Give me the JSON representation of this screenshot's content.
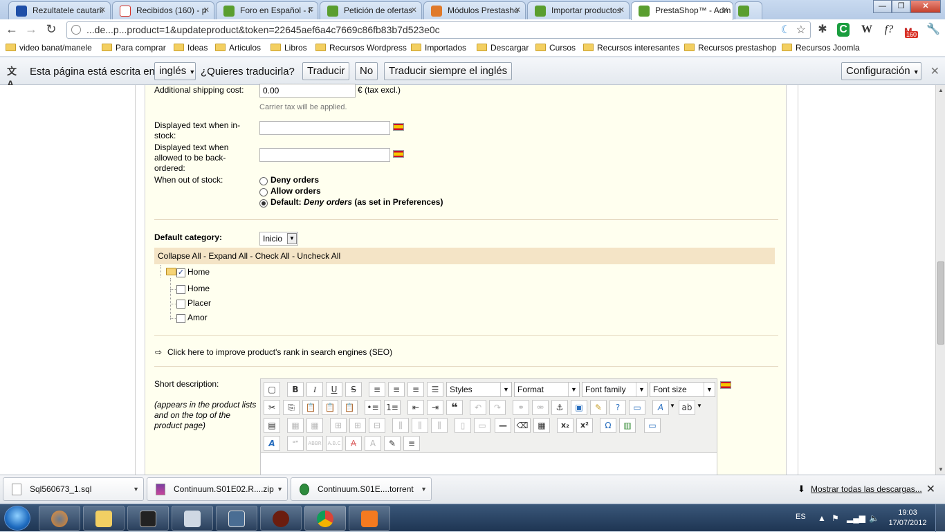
{
  "tabs": [
    {
      "label": "Rezultatele cautarii",
      "icon": "forum-icon",
      "color": "#1f4fa8"
    },
    {
      "label": "Recibidos (160) - p",
      "icon": "gmail-icon",
      "color": "#d93025"
    },
    {
      "label": "Foro en Español - F",
      "icon": "prestashop-icon",
      "color": "#5a9e2f"
    },
    {
      "label": "Petición de ofertas",
      "icon": "prestashop-icon",
      "color": "#5a9e2f"
    },
    {
      "label": "Módulos Prestasho",
      "icon": "job-icon",
      "color": "#e07a2b"
    },
    {
      "label": "Importar productos",
      "icon": "prestashop-icon",
      "color": "#5a9e2f"
    },
    {
      "label": "PrestaShop™ - Adm",
      "icon": "prestashop-icon",
      "color": "#5a9e2f"
    }
  ],
  "address": "...de...p...product=1&updateproduct&token=22645aef6a4c7669c86fb83b7d523e0c",
  "extensions": {
    "gmail_count": "160"
  },
  "bookmarks": [
    "video banat/manele",
    "Para comprar",
    "Ideas",
    "Articulos",
    "Libros",
    "Recursos Wordpress",
    "Importados",
    "Descargar",
    "Cursos",
    "Recursos interesantes",
    "Recursos prestashop",
    "Recursos Joomla"
  ],
  "translate": {
    "prefix": "Esta página está escrita en",
    "language": "inglés",
    "question": "¿Quieres traducirla?",
    "translate_btn": "Traducir",
    "no_btn": "No",
    "always_btn": "Traducir siempre el inglés",
    "config_btn": "Configuración"
  },
  "form": {
    "shipping_label": "Additional shipping cost:",
    "shipping_value": "0.00",
    "shipping_unit": "€ (tax excl.)",
    "carrier_hint": "Carrier tax will be applied.",
    "instock_label": "Displayed text when in-stock:",
    "backorder_label": "Displayed text when allowed to be back-ordered:",
    "out_of_stock_label": "When out of stock:",
    "options": {
      "deny": "Deny orders",
      "allow": "Allow orders",
      "default_prefix": "Default:",
      "default_italic": "Deny orders",
      "default_suffix": "(as set in Preferences)"
    },
    "selected_option": "default",
    "category_label": "Default category:",
    "category_value": "Inicio",
    "tree_actions": "Collapse All - Expand All - Check All - Uncheck All",
    "tree": [
      {
        "label": "Home",
        "checked": true,
        "root": true
      },
      {
        "label": "Home",
        "checked": false
      },
      {
        "label": "Placer",
        "checked": false
      },
      {
        "label": "Amor",
        "checked": false
      }
    ],
    "seo_link": "Click here to improve product's rank in search engines (SEO)",
    "short_desc_label": "Short description:",
    "short_desc_hint": "(appears in the product lists and on the top of the product page)"
  },
  "editor": {
    "selects": [
      "Styles",
      "Format",
      "Font family",
      "Font size"
    ]
  },
  "downloads": {
    "items": [
      "Sql560673_1.sql",
      "Continuum.S01E02.R....zip",
      "Continuum.S01E....torrent"
    ],
    "show_all": "Mostrar todas las descargas..."
  },
  "taskbar": {
    "lang": "ES",
    "time": "19:03",
    "date": "17/07/2012"
  }
}
